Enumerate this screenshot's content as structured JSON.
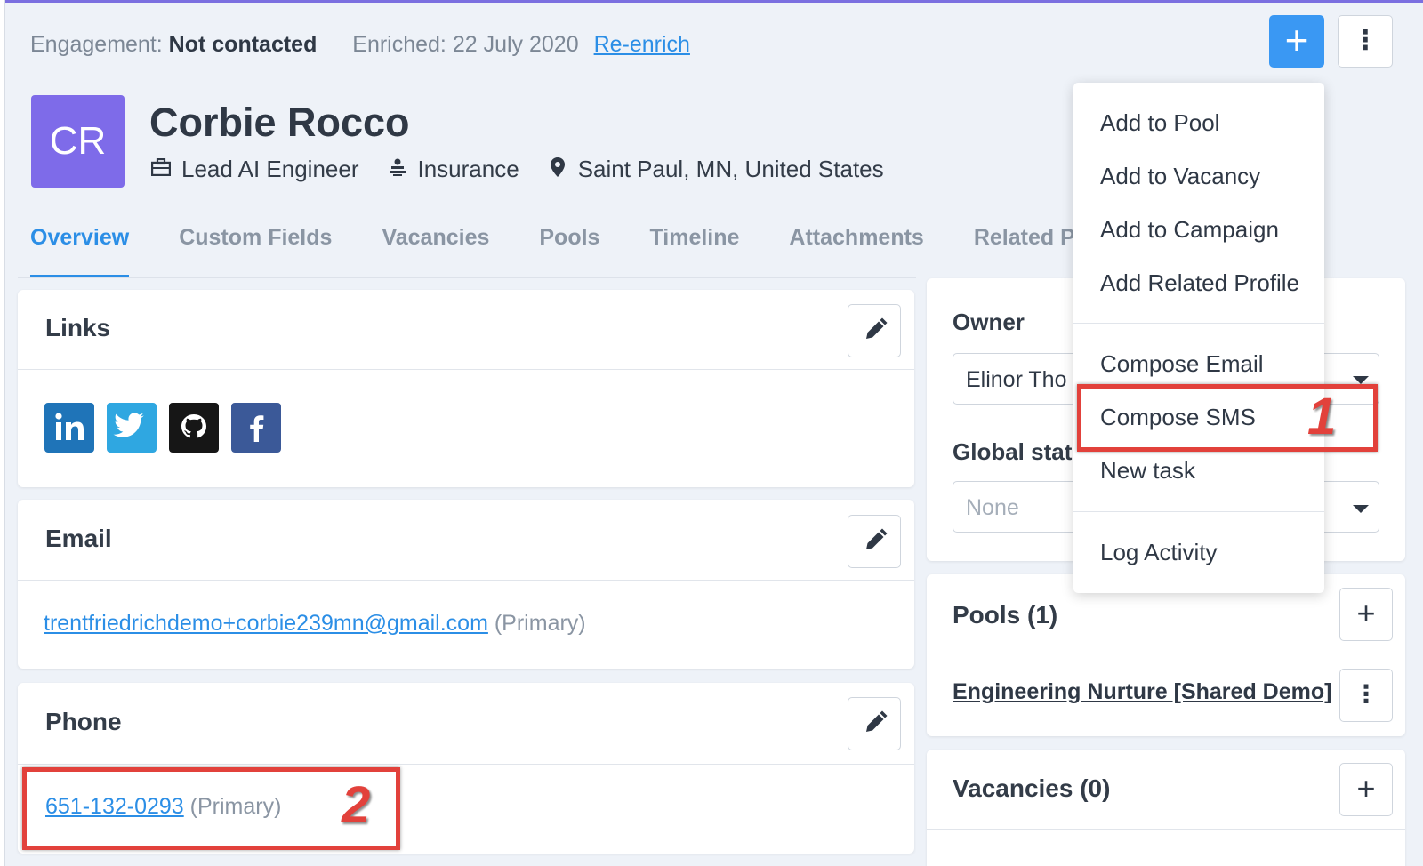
{
  "header": {
    "engagement_label": "Engagement:",
    "engagement_value": "Not contacted",
    "enriched_label": "Enriched:",
    "enriched_date": "22 July 2020",
    "reenrich_link": "Re-enrich",
    "add_button": "+",
    "more_button": "⋮"
  },
  "profile": {
    "initials": "CR",
    "avatar_color": "#7e6be9",
    "name": "Corbie Rocco",
    "title": "Lead AI Engineer",
    "industry": "Insurance",
    "location": "Saint Paul, MN, United States"
  },
  "tabs": [
    "Overview",
    "Custom Fields",
    "Vacancies",
    "Pools",
    "Timeline",
    "Attachments",
    "Related P"
  ],
  "links_card": {
    "title": "Links",
    "socials": [
      "linkedin",
      "twitter",
      "github",
      "facebook"
    ]
  },
  "email_card": {
    "title": "Email",
    "email": "trentfriedrichdemo+corbie239mn@gmail.com",
    "tag": "(Primary)"
  },
  "phone_card": {
    "title": "Phone",
    "phone": "651-132-0293",
    "tag": "(Primary)"
  },
  "owner_card": {
    "owner_label": "Owner",
    "owner_value": "Elinor Tho",
    "global_status_label": "Global statu",
    "global_status_value": "None"
  },
  "pools_card": {
    "title": "Pools (1)",
    "pool_name": "Engineering Nurture [Shared Demo]"
  },
  "vacancies_card": {
    "title": "Vacancies (0)"
  },
  "menu": {
    "items": [
      "Add to Pool",
      "Add to Vacancy",
      "Add to Campaign",
      "Add Related Profile",
      "Compose Email",
      "Compose SMS",
      "New task",
      "Log Activity"
    ]
  },
  "annotations": {
    "step1": "1",
    "step2": "2"
  },
  "colors": {
    "accent": "#2b8ee6",
    "primary_button": "#3a98f3",
    "annotation_red": "#e2413b"
  }
}
